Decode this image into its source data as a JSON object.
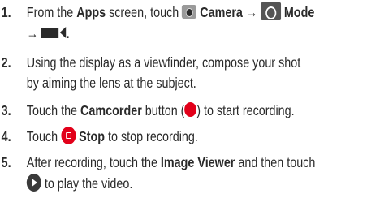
{
  "steps": [
    {
      "num": "1.",
      "p1": "From the ",
      "b1": "Apps",
      "p2": " screen, touch ",
      "b2": "Camera",
      "arrow1": " → ",
      "b3": "Mode",
      "arrow2": "→ "
    },
    {
      "num": "2.",
      "line1": "Using the display as a viewfinder, compose your shot",
      "line2": "by aiming the lens at the subject."
    },
    {
      "num": "3.",
      "p1": "Touch the ",
      "b1": "Camcorder",
      "p2": " button (",
      "p3": ") to start recording."
    },
    {
      "num": "4.",
      "p1": "Touch ",
      "b1": "Stop",
      "p2": " to stop recording."
    },
    {
      "num": "5.",
      "p1": "After recording, touch the ",
      "b1": "Image Viewer",
      "p2": " and then touch",
      "p3": " to play the video."
    }
  ],
  "icons": [
    "camera-icon",
    "camera-mode-icon",
    "camcorder-icon",
    "record-button-icon",
    "stop-icon",
    "play-icon"
  ],
  "colors": {
    "text": "#2a2a2a",
    "record_red": "#e2001a",
    "icon_gray": "#555555"
  }
}
